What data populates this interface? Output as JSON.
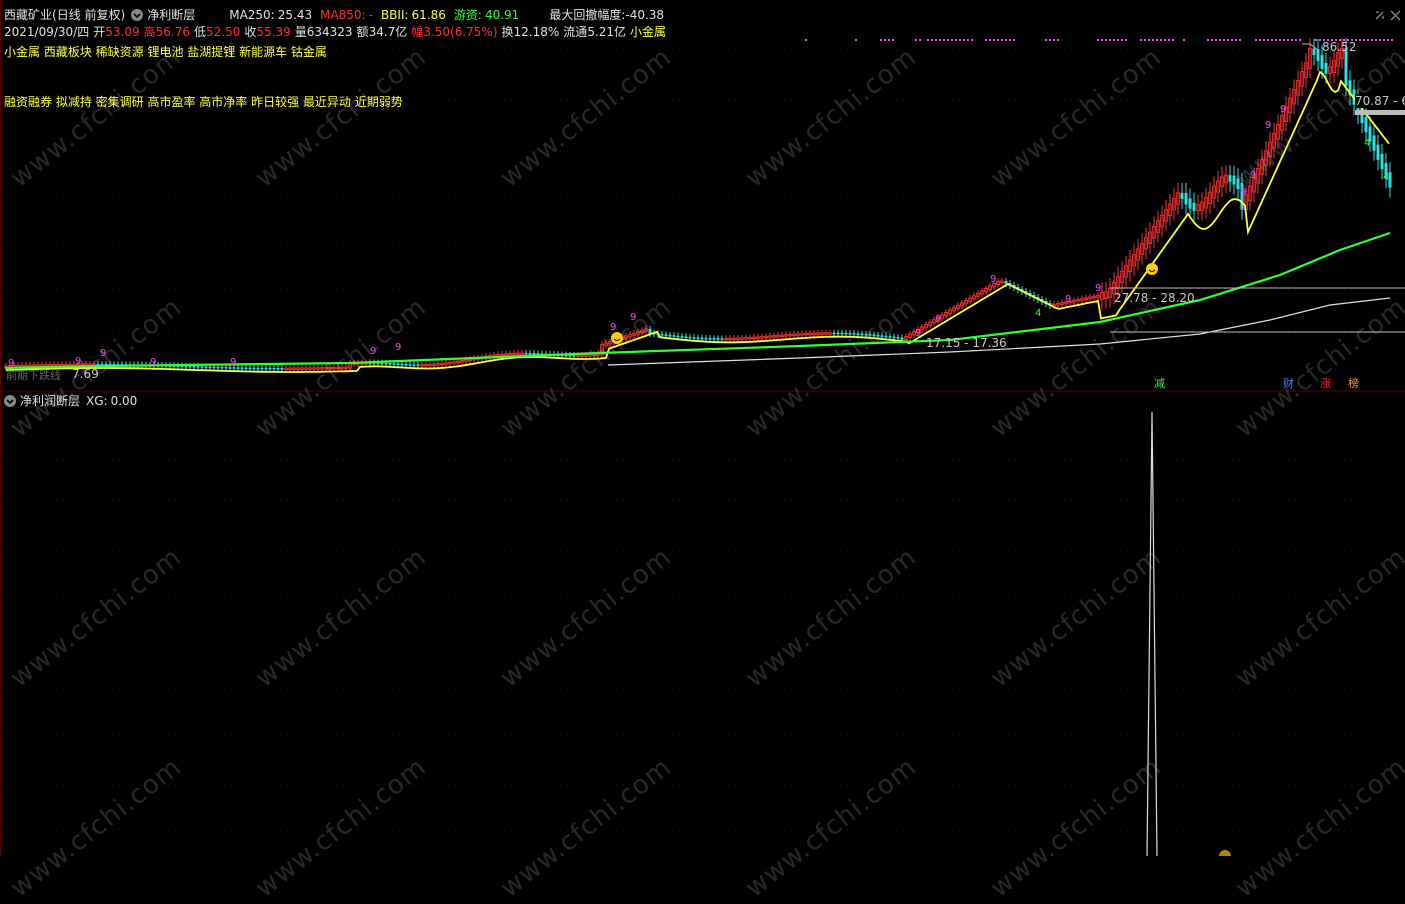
{
  "header": {
    "stock_name": "西藏矿业",
    "period": "(日线 前复权)",
    "formula": "净利断层",
    "ma250_label": "MA250:",
    "ma250_value": "25.43",
    "ma850_label": "MA850:",
    "ma850_value": "-",
    "bbi_label": "BBII:",
    "bbi_value": "61.86",
    "youzi_label": "游资:",
    "youzi_value": "40.91",
    "drawdown_label": "最大回撤幅度:",
    "drawdown_value": "-40.38"
  },
  "quote": {
    "date": "2021/09/30/四",
    "open_label": "开",
    "open": "53.09",
    "high_label": "高",
    "high": "56.76",
    "low_label": "低",
    "low": "52.50",
    "close_label": "收",
    "close": "55.39",
    "volume_label": "量",
    "volume": "634323",
    "amount_label": "额",
    "amount": "34.7亿",
    "change_label": "幅",
    "change": "3.50(6.75%)",
    "turnover_label": "换",
    "turnover": "12.18%",
    "float_label": "流通",
    "float": "5.21亿",
    "sector": "小金属"
  },
  "concept_tags": "小金属 西藏板块 稀缺资源 锂电池 盐湖提锂 新能源车 钴金属",
  "signal_tags": "融资融券 拟减持 密集调研 高市盈率 高市净率 昨日较强 最近异动 近期弱势",
  "price_annotations": {
    "high_price": "86.52",
    "right_price": "70.87 - 6",
    "box1": "27.78 - 28.20",
    "box2": "17.15 - 17.36",
    "low_price": "7.69",
    "bottom_left": "前期下跌线"
  },
  "event_markers": [
    "减",
    "财",
    "涨",
    "榜"
  ],
  "lower_panel": {
    "title": "净利润断层",
    "xg_label": "XG:",
    "xg_value": "0.00"
  },
  "watermark": "www.cfchi.com",
  "colors": {
    "up": "#ff3030",
    "down": "#30e0e0",
    "ma_yellow": "#ffff30",
    "ma_green": "#30ff30",
    "ma_white": "#e0e0e0",
    "label_yellow": "#ffff40",
    "magenta": "#ff40ff",
    "background": "#000000"
  },
  "icons": [
    "chevron-down-icon",
    "smiley-icon",
    "settings-icon",
    "close-icon"
  ]
}
